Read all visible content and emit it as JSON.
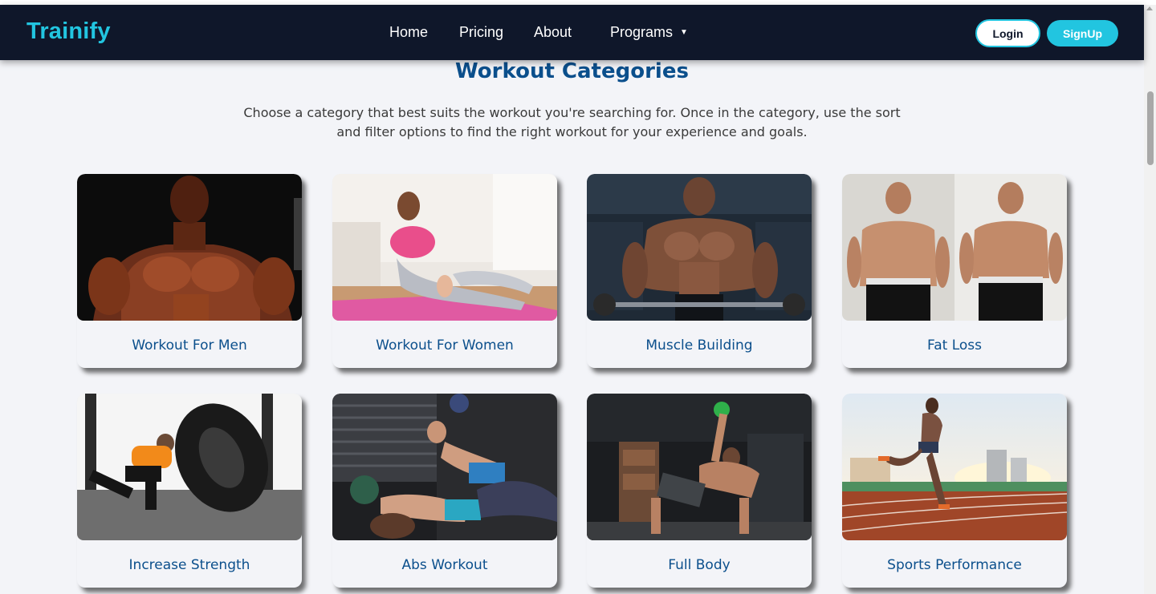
{
  "nav": {
    "brand": "Trainify",
    "links": [
      "Home",
      "Pricing",
      "About",
      "Programs"
    ],
    "programs_caret": "▼",
    "login_label": "Login",
    "signup_label": "SignUp"
  },
  "section": {
    "title": "Workout Categories",
    "description": "Choose a category that best suits the workout you're searching for. Once in the category, use the sort and filter options to find the right workout for your experience and goals."
  },
  "categories": [
    {
      "label": "Workout For Men",
      "image": "bodybuilder-photo"
    },
    {
      "label": "Workout For Women",
      "image": "yoga-stretch-photo"
    },
    {
      "label": "Muscle Building",
      "image": "barbell-curl-photo"
    },
    {
      "label": "Fat Loss",
      "image": "before-after-photo"
    },
    {
      "label": "Increase Strength",
      "image": "tire-flip-photo"
    },
    {
      "label": "Abs Workout",
      "image": "medicine-ball-situps-photo"
    },
    {
      "label": "Full Body",
      "image": "kettlebell-getup-photo"
    },
    {
      "label": "Sports Performance",
      "image": "track-sprint-photo"
    }
  ],
  "colors": {
    "navbar_bg": "#0f172a",
    "accent": "#22c5e0",
    "heading": "#0b4f8c",
    "page_bg": "#f3f4f8"
  }
}
